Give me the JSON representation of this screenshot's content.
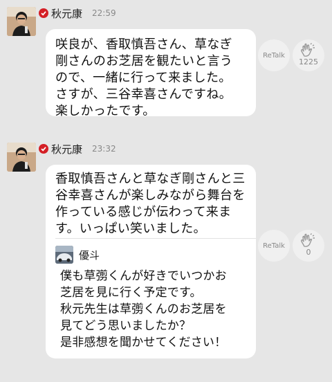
{
  "posts": [
    {
      "author": "秋元康",
      "time": "22:59",
      "lines": [
        "咲良が、香取慎吾さん、草なぎ",
        "剛さんのお芝居を観たいと言う",
        "ので、一緒に行って来ました。",
        "さすが、三谷幸喜さんですね。",
        "楽しかったです。"
      ],
      "retalk_label": "ReTalk",
      "clap_count": "1225"
    },
    {
      "author": "秋元康",
      "time": "23:32",
      "lines": [
        "香取慎吾さんと草なぎ剛さんと三",
        "谷幸喜さんが楽しみながら舞台を",
        "作っている感じが伝わって来ま",
        "す。いっぱい笑いました。"
      ],
      "quote": {
        "author": "優斗",
        "lines": [
          "僕も草彅くんが好きでいつかお",
          "芝居を見に行く予定です。",
          "秋元先生は草彅くんのお芝居を",
          "見てどう思いましたか？",
          "是非感想を聞かせてください！"
        ]
      },
      "retalk_label": "ReTalk",
      "clap_count": "0"
    }
  ],
  "icons": {
    "verified": "check-badge-icon",
    "clap": "clapping-hands-icon"
  },
  "colors": {
    "background": "#e6e6e6",
    "badge": "#d41f26"
  }
}
